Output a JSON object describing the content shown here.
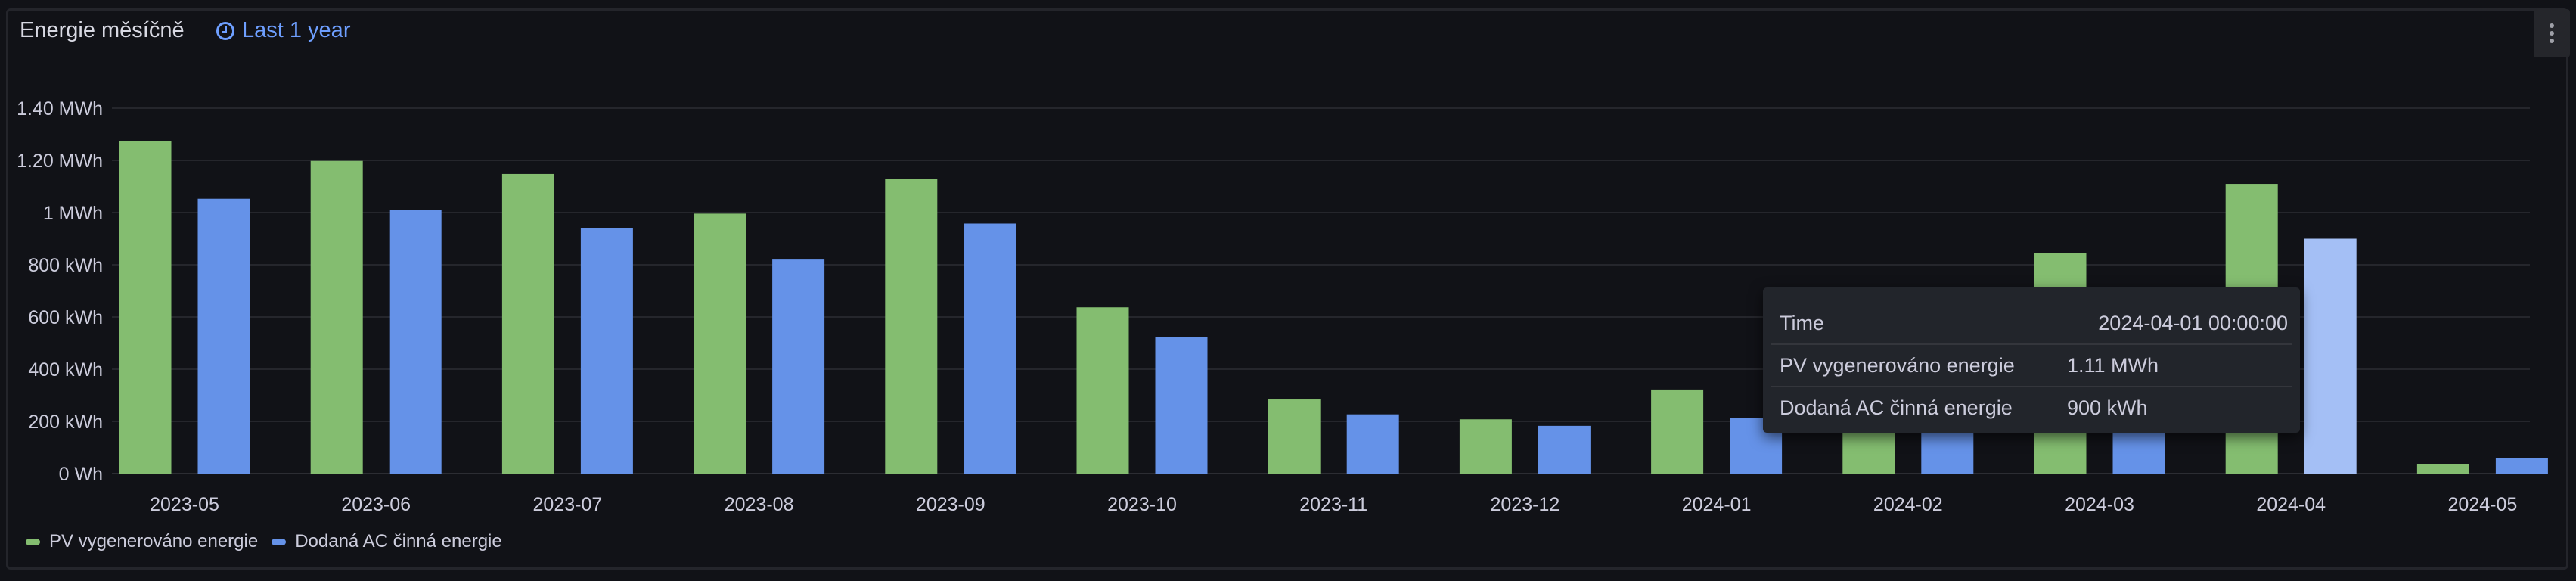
{
  "panel": {
    "title": "Energie měsíčně",
    "time_range": "Last 1 year",
    "menu_icon": "vertical-ellipsis-icon",
    "time_icon": "clock-icon"
  },
  "colors": {
    "pv": "#84bd70",
    "ac": "#6592e8",
    "ac_highlight": "#a4bff5",
    "grid": "#25262c",
    "background": "#111217"
  },
  "chart_data": {
    "type": "bar",
    "title": "Energie měsíčně",
    "xlabel": "",
    "ylabel": "",
    "unit": "kWh",
    "ylim": [
      0,
      1400
    ],
    "yticks": [
      0,
      200,
      400,
      600,
      800,
      1000,
      1200,
      1400
    ],
    "ytick_labels": [
      "0 Wh",
      "200 kWh",
      "400 kWh",
      "600 kWh",
      "800 kWh",
      "1 MWh",
      "1.20 MWh",
      "1.40 MWh"
    ],
    "grid": true,
    "legend_position": "bottom-left",
    "categories": [
      "2023-05",
      "2023-06",
      "2023-07",
      "2023-08",
      "2023-09",
      "2023-10",
      "2023-11",
      "2023-12",
      "2024-01",
      "2024-02",
      "2024-03",
      "2024-04",
      "2024-05"
    ],
    "series": [
      {
        "name": "PV vygenerováno energie",
        "values": [
          1274,
          1198,
          1148,
          996,
          1129,
          637,
          284,
          208,
          322,
          560,
          846,
          1110,
          37
        ]
      },
      {
        "name": "Dodaná AC činná energie",
        "values": [
          1053,
          1009,
          940,
          820,
          958,
          523,
          227,
          183,
          214,
          420,
          650,
          900,
          60
        ]
      }
    ],
    "highlighted_category": "2024-04"
  },
  "tooltip": {
    "rows": [
      {
        "label": "Time",
        "value": "2024-04-01 00:00:00"
      },
      {
        "label": "PV vygenerováno energie",
        "value": "1.11 MWh"
      },
      {
        "label": "Dodaná AC činná energie",
        "value": "900 kWh"
      }
    ]
  }
}
